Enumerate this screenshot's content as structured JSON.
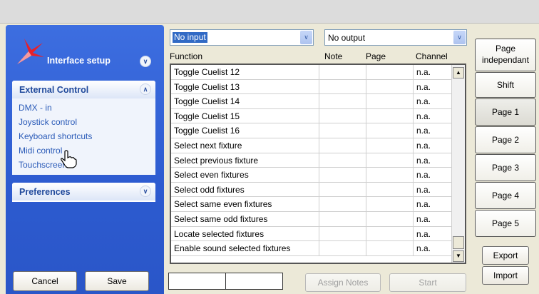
{
  "sidebar": {
    "title": "Interface setup",
    "external_control": {
      "title": "External Control",
      "items": [
        "DMX - in",
        "Joystick control",
        "Keyboard shortcuts",
        "Midi control",
        "Touchscreen"
      ]
    },
    "preferences": {
      "title": "Preferences"
    },
    "cancel_label": "Cancel",
    "save_label": "Save"
  },
  "input_select": {
    "value": "No input"
  },
  "output_select": {
    "value": "No output"
  },
  "columns": [
    "Function",
    "Note",
    "Page",
    "Channel"
  ],
  "rows": [
    {
      "function": "Toggle Cuelist 12",
      "note": "",
      "page": "",
      "channel": "n.a."
    },
    {
      "function": "Toggle Cuelist 13",
      "note": "",
      "page": "",
      "channel": "n.a."
    },
    {
      "function": "Toggle Cuelist 14",
      "note": "",
      "page": "",
      "channel": "n.a."
    },
    {
      "function": "Toggle Cuelist 15",
      "note": "",
      "page": "",
      "channel": "n.a."
    },
    {
      "function": "Toggle Cuelist 16",
      "note": "",
      "page": "",
      "channel": "n.a."
    },
    {
      "function": "Select next fixture",
      "note": "",
      "page": "",
      "channel": "n.a."
    },
    {
      "function": "Select previous fixture",
      "note": "",
      "page": "",
      "channel": "n.a."
    },
    {
      "function": "Select even fixtures",
      "note": "",
      "page": "",
      "channel": "n.a."
    },
    {
      "function": "Select odd fixtures",
      "note": "",
      "page": "",
      "channel": "n.a."
    },
    {
      "function": "Select same even fixtures",
      "note": "",
      "page": "",
      "channel": "n.a."
    },
    {
      "function": "Select same odd fixtures",
      "note": "",
      "page": "",
      "channel": "n.a."
    },
    {
      "function": "Locate selected fixtures",
      "note": "",
      "page": "",
      "channel": "n.a."
    },
    {
      "function": "Enable sound selected fixtures",
      "note": "",
      "page": "",
      "channel": "n.a."
    }
  ],
  "bottom": {
    "assign_label": "Assign Notes",
    "start_label": "Start"
  },
  "right_panel": {
    "page_independant": "Page independant",
    "shift": "Shift",
    "pages": [
      "Page 1",
      "Page 2",
      "Page 3",
      "Page 4",
      "Page 5"
    ],
    "export_label": "Export",
    "import_label": "Import"
  },
  "icons": {
    "chevron_down": "chevron-down-icon",
    "chevron_up": "chevron-up-icon",
    "logo": "app-logo-icon",
    "cursor": "hand-pointer-icon"
  }
}
